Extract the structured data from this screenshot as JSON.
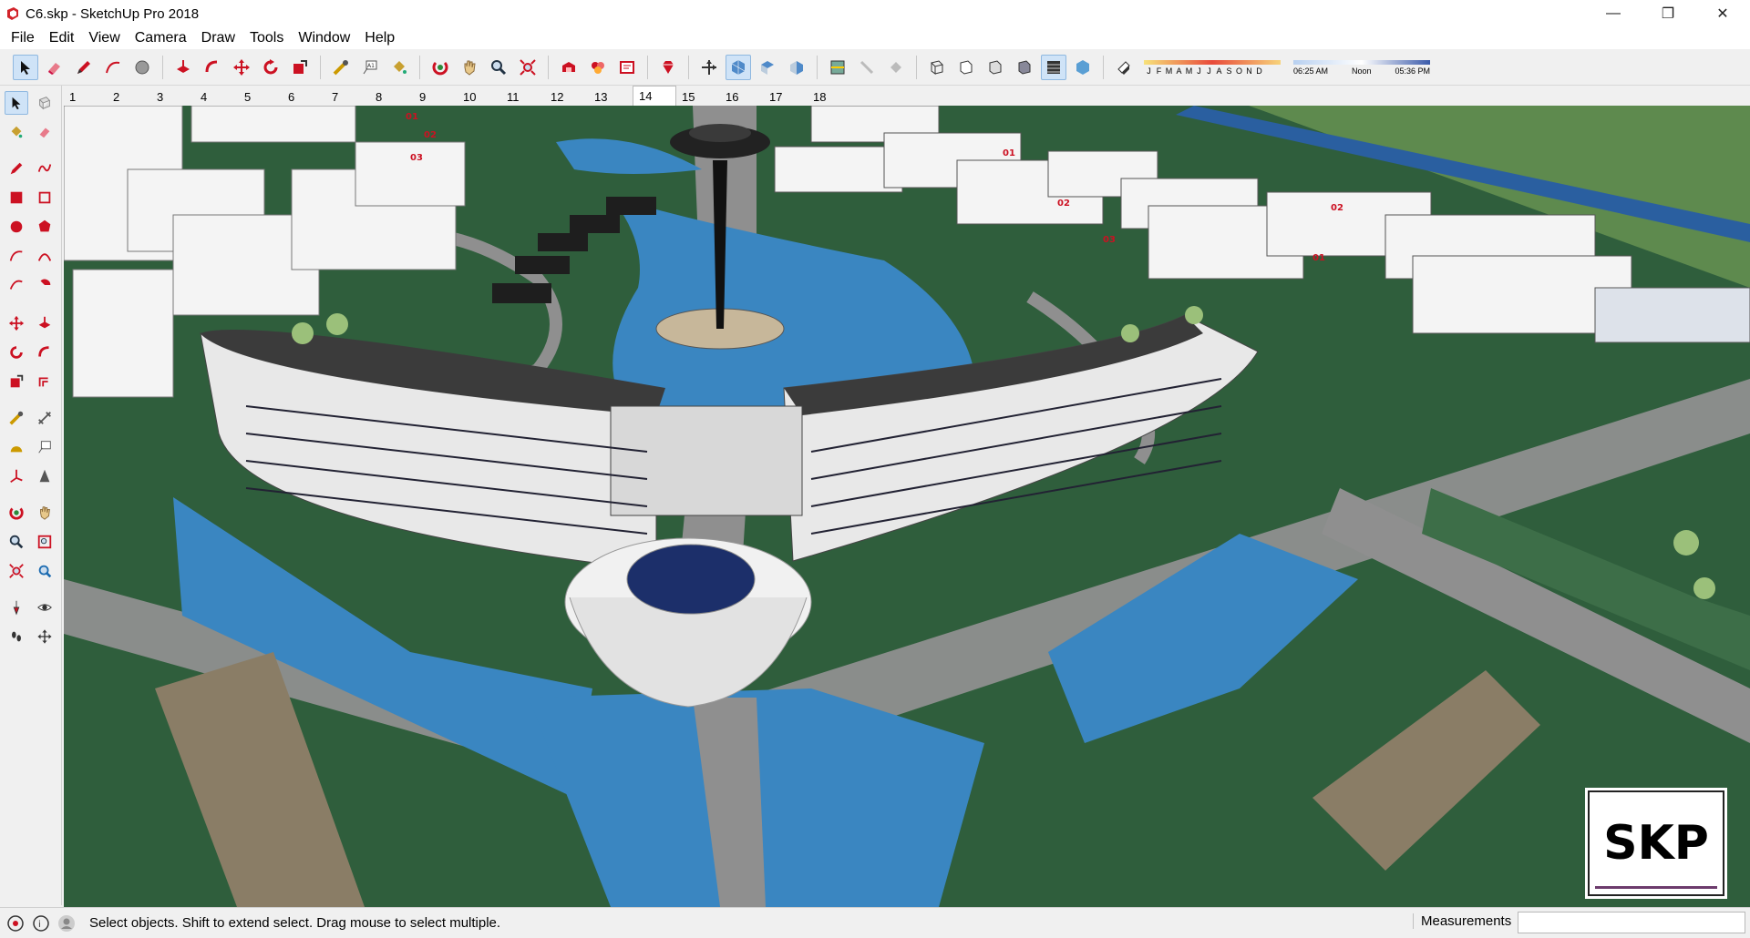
{
  "window": {
    "title": "C6.skp - SketchUp Pro 2018",
    "controls": {
      "minimize": "—",
      "restore": "❐",
      "close": "✕"
    }
  },
  "menu": [
    "File",
    "Edit",
    "View",
    "Camera",
    "Draw",
    "Tools",
    "Window",
    "Help"
  ],
  "toolbar": {
    "shadow_months": [
      "J",
      "F",
      "M",
      "A",
      "M",
      "J",
      "J",
      "A",
      "S",
      "O",
      "N",
      "D"
    ],
    "time_start": "06:25 AM",
    "time_mid": "Noon",
    "time_end": "05:36 PM"
  },
  "scenes": {
    "tabs": [
      "1",
      "2",
      "3",
      "4",
      "5",
      "6",
      "7",
      "8",
      "9",
      "10",
      "11",
      "12",
      "13",
      "14",
      "15",
      "16",
      "17",
      "18"
    ],
    "active": "14"
  },
  "status": {
    "text": "Select objects. Shift to extend select. Drag mouse to select multiple.",
    "measurements_label": "Measurements",
    "measurements_value": ""
  },
  "model": {
    "badge": "SKP",
    "building_labels": [
      "01",
      "02",
      "03",
      "01",
      "02",
      "03",
      "02",
      "01"
    ]
  },
  "colors": {
    "accent": "#cfe3f7",
    "lawn": "#2f5e3c",
    "water": "#3a86c1",
    "road": "#8f8f8f",
    "roof": "#3b3b3b"
  }
}
